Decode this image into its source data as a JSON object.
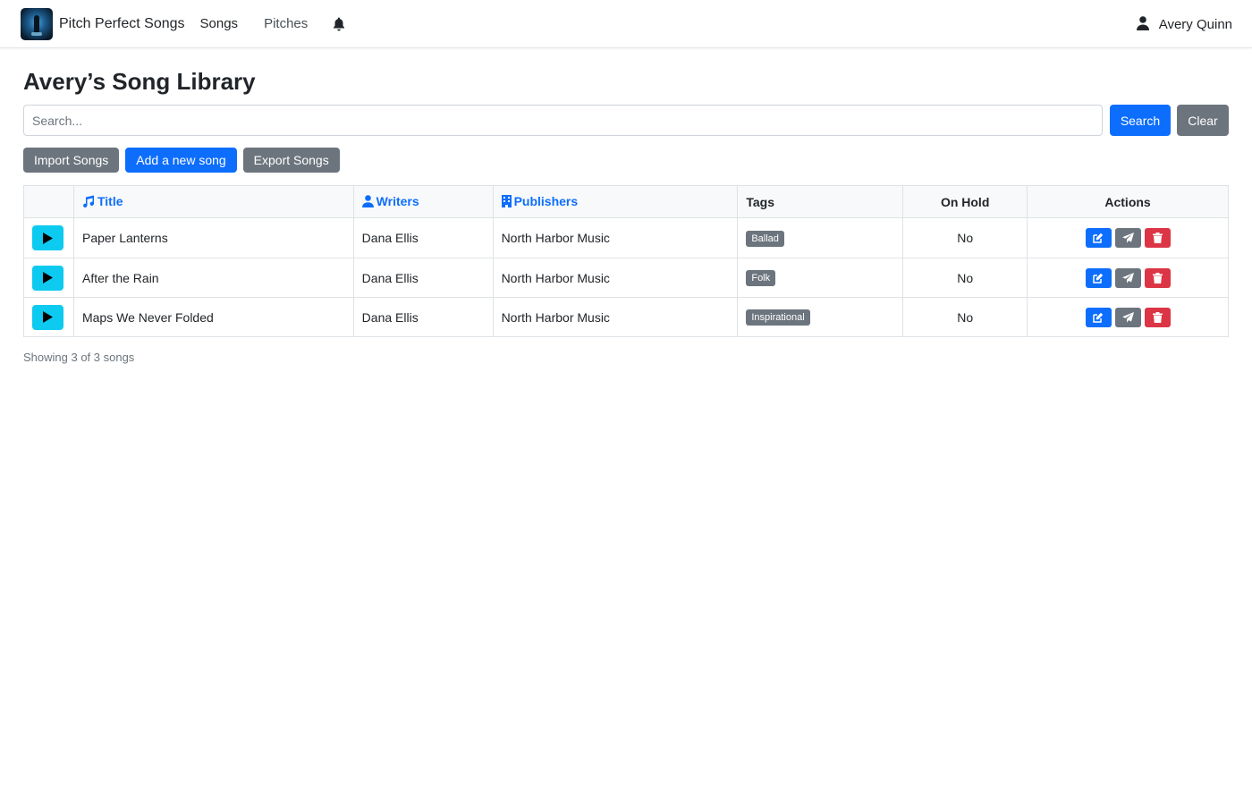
{
  "navbar": {
    "brand": "Pitch Perfect Songs",
    "songs": "Songs",
    "pitches": "Pitches",
    "user": "Avery Quinn"
  },
  "page": {
    "title": "Avery’s Song Library"
  },
  "search": {
    "placeholder": "Search...",
    "value": "",
    "search_label": "Search",
    "clear_label": "Clear"
  },
  "toolbar": {
    "import": "Import Songs",
    "add": "Add a new song",
    "export": "Export Songs"
  },
  "table": {
    "headers": {
      "title": "Title",
      "writers": "Writers",
      "publishers": "Publishers",
      "tags": "Tags",
      "on_hold": "On Hold",
      "actions": "Actions"
    },
    "rows": [
      {
        "title": "Paper Lanterns",
        "writers": "Dana Ellis",
        "publishers": "North Harbor Music",
        "tag": "Ballad",
        "on_hold": "No"
      },
      {
        "title": "After the Rain",
        "writers": "Dana Ellis",
        "publishers": "North Harbor Music",
        "tag": "Folk",
        "on_hold": "No"
      },
      {
        "title": "Maps We Never Folded",
        "writers": "Dana Ellis",
        "publishers": "North Harbor Music",
        "tag": "Inspirational",
        "on_hold": "No"
      }
    ]
  },
  "footer": {
    "count": "Showing 3 of 3 songs"
  },
  "colors": {
    "primary": "#0d6efd",
    "secondary": "#6c757d",
    "info": "#0dcaf0",
    "danger": "#dc3545"
  },
  "icons": {
    "logo": "microphone-logo",
    "bell": "bell-icon",
    "user": "user-icon",
    "title": "music-note-icon",
    "writers": "person-icon",
    "publishers": "building-icon",
    "play": "play-icon",
    "edit": "edit-icon",
    "pitch": "paper-plane-icon",
    "delete": "trash-icon"
  }
}
